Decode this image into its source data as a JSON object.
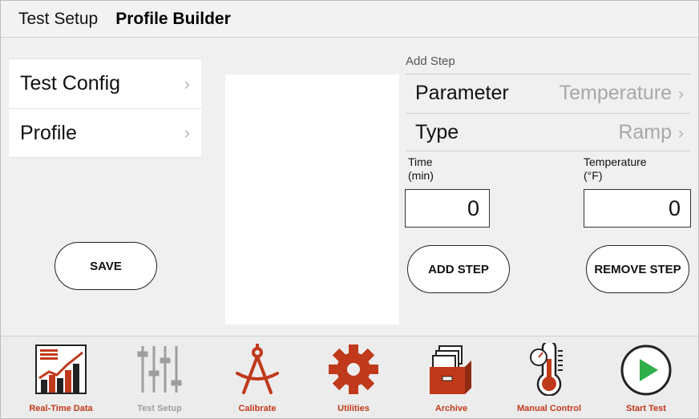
{
  "header": {
    "breadcrumb": "Test Setup",
    "title": "Profile Builder"
  },
  "sidebar": {
    "items": [
      {
        "label": "Test Config",
        "chevron": "›"
      },
      {
        "label": "Profile",
        "chevron": "›"
      }
    ],
    "save_label": "SAVE"
  },
  "add_step": {
    "title": "Add Step",
    "parameter": {
      "label": "Parameter",
      "value": "Temperature",
      "chevron": "›"
    },
    "type": {
      "label": "Type",
      "value": "Ramp",
      "chevron": "›"
    },
    "time": {
      "label_line1": "Time",
      "label_line2": "(min)",
      "value": "0"
    },
    "temperature": {
      "label_line1": "Temperature",
      "label_line2": "(°F)",
      "value": "0"
    },
    "add_label": "ADD STEP",
    "remove_label": "REMOVE STEP"
  },
  "toolbar": {
    "items": [
      {
        "label": "Real-Time Data",
        "icon": "chart-icon"
      },
      {
        "label": "Test Setup",
        "icon": "sliders-icon"
      },
      {
        "label": "Calibrate",
        "icon": "compass-icon"
      },
      {
        "label": "Utilities",
        "icon": "gear-icon"
      },
      {
        "label": "Archive",
        "icon": "archive-box-icon"
      },
      {
        "label": "Manual Control",
        "icon": "thermometer-icon"
      },
      {
        "label": "Start Test",
        "icon": "play-icon"
      }
    ]
  },
  "colors": {
    "accent": "#c0391b",
    "play_green": "#2fae4a",
    "disabled": "#9e9e9e"
  }
}
